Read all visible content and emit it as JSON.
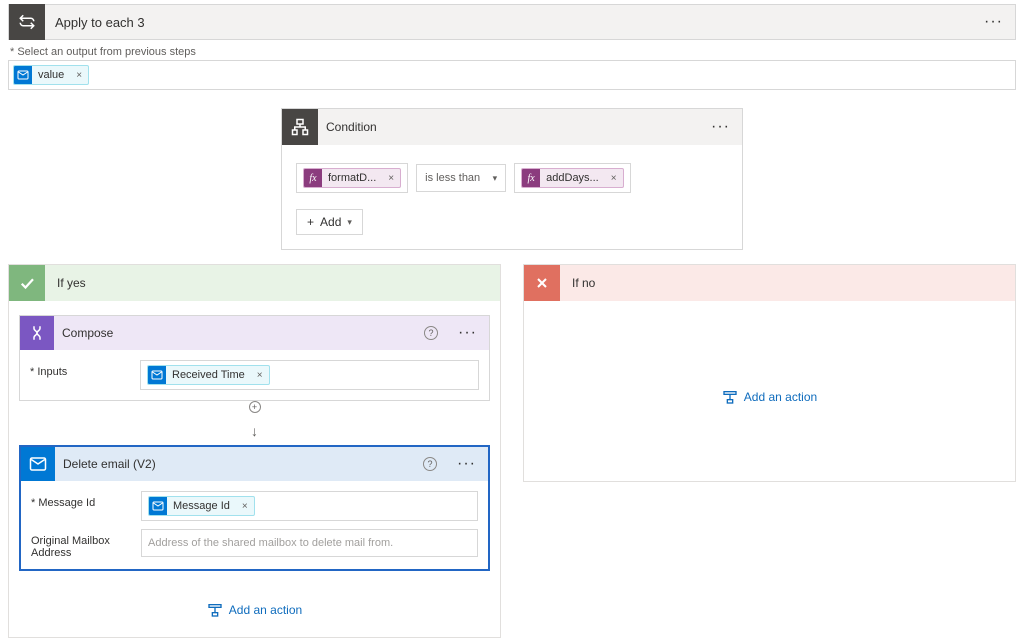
{
  "top": {
    "title": "Apply to each 3"
  },
  "output": {
    "label": "* Select an output from previous steps",
    "token": "value"
  },
  "condition": {
    "title": "Condition",
    "left_token": "formatD...",
    "operator": "is less than",
    "right_token": "addDays...",
    "add_label": "Add"
  },
  "branches": {
    "yes": {
      "title": "If yes",
      "compose": {
        "title": "Compose",
        "inputs_label": "* Inputs",
        "inputs_token": "Received Time"
      },
      "delete": {
        "title": "Delete email (V2)",
        "msgid_label": "* Message Id",
        "msgid_token": "Message Id",
        "mailbox_label": "Original Mailbox Address",
        "mailbox_placeholder": "Address of the shared mailbox to delete mail from."
      },
      "add_action": "Add an action"
    },
    "no": {
      "title": "If no",
      "add_action": "Add an action"
    }
  }
}
